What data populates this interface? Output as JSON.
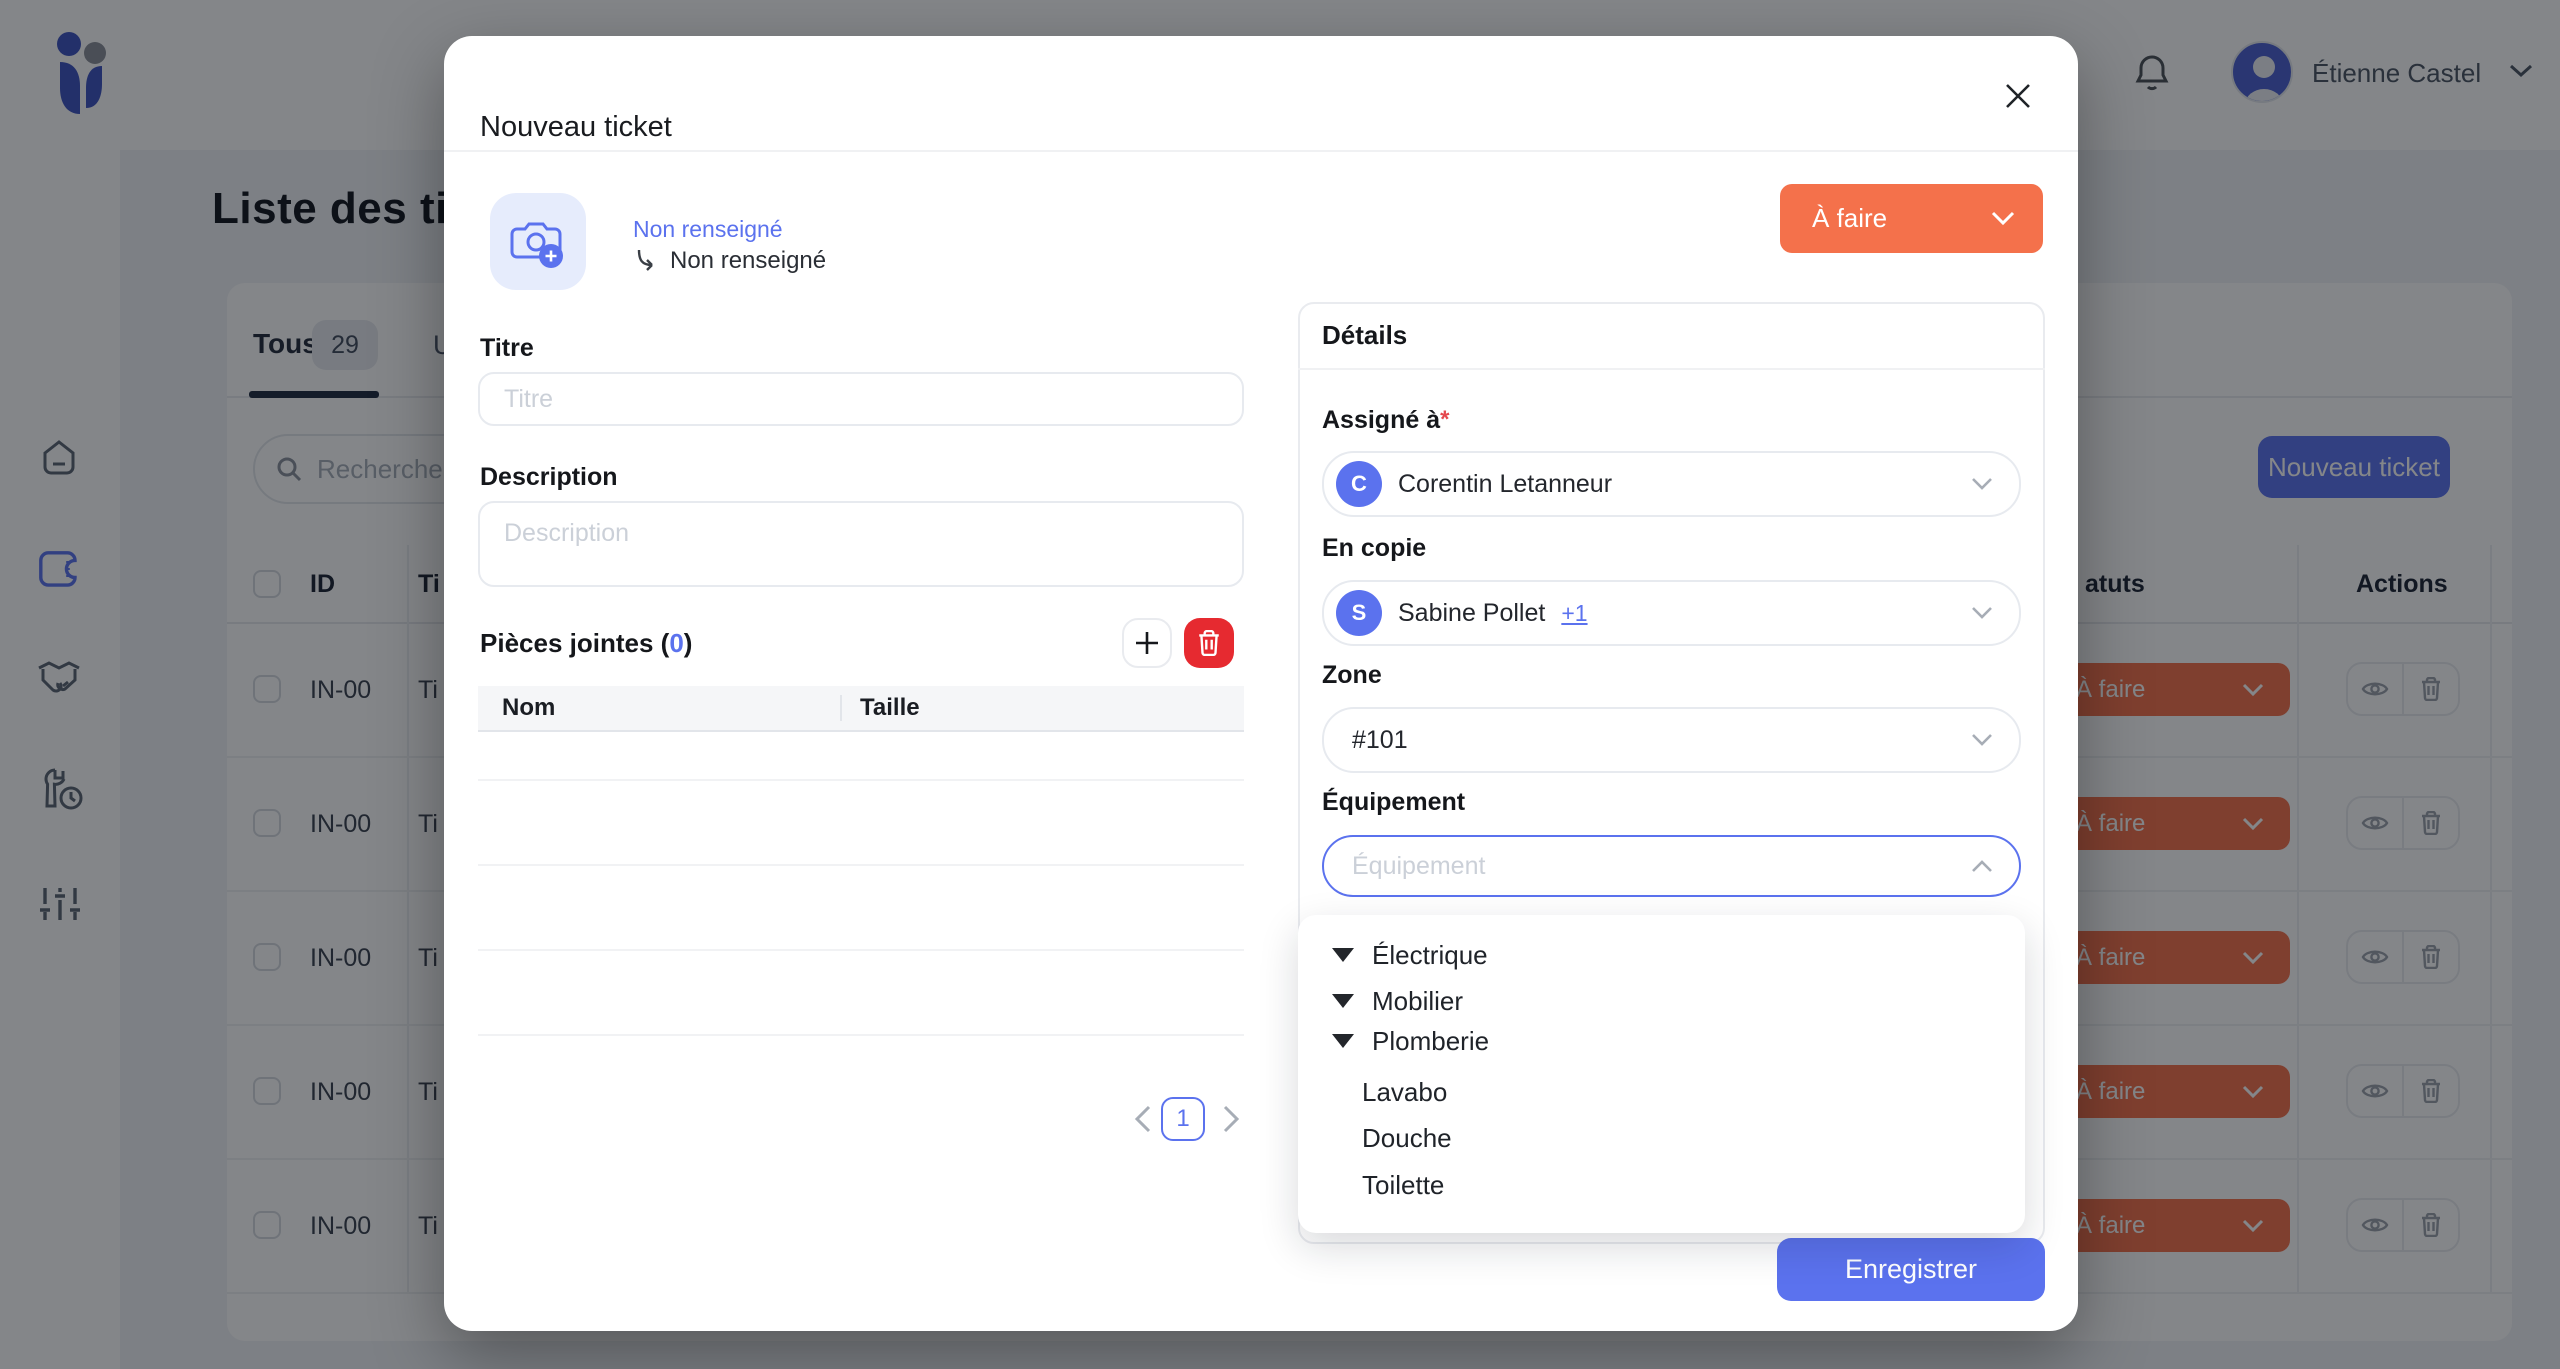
{
  "colors": {
    "accent": "#5B72EE",
    "orange": "#F4714B",
    "red": "#E62A30",
    "navy": "#1E2A40"
  },
  "topbar": {
    "user_name": "Étienne Castel"
  },
  "page": {
    "title": "Liste des ti",
    "tabs": {
      "all_label": "Tous",
      "all_count": "29",
      "second_label": "U"
    },
    "search_placeholder": "Rechercher",
    "new_ticket_label": "Nouveau ticket",
    "table": {
      "col_id": "ID",
      "col_title": "Ti",
      "col_status": "atuts",
      "col_actions": "Actions",
      "rows": [
        {
          "id": "IN-00",
          "title": "Ti",
          "status": "À faire"
        },
        {
          "id": "IN-00",
          "title": "Ti",
          "status": "À faire"
        },
        {
          "id": "IN-00",
          "title": "Ti",
          "status": "À faire"
        },
        {
          "id": "IN-00",
          "title": "Ti",
          "status": "À faire"
        },
        {
          "id": "IN-00",
          "title": "Ti",
          "status": "À faire"
        }
      ]
    }
  },
  "modal": {
    "title": "Nouveau ticket",
    "photo_link": "Non renseigné",
    "photo_secondary": "Non renseigné",
    "status_value": "À faire",
    "title_field": {
      "label": "Titre",
      "placeholder": "Titre"
    },
    "description_field": {
      "label": "Description",
      "placeholder": "Description"
    },
    "attachments": {
      "label_prefix": "Pièces jointes (",
      "count": "0",
      "label_suffix": ")",
      "col_name": "Nom",
      "col_size": "Taille",
      "page_number": "1"
    },
    "details": {
      "heading": "Détails",
      "assigned_label": "Assigné à",
      "required_marker": "*",
      "assigned_value": "Corentin Letanneur",
      "assigned_initial": "C",
      "copy_label": "En copie",
      "copy_value": "Sabine Pollet",
      "copy_extra": "+1",
      "copy_initial": "S",
      "zone_label": "Zone",
      "zone_value": "#101",
      "equipment_label": "Équipement",
      "equipment_placeholder": "Équipement",
      "dropdown_items": [
        {
          "label": "Électrique"
        },
        {
          "label": "Mobilier"
        },
        {
          "label": "Plomberie"
        },
        {
          "label": "Lavabo"
        },
        {
          "label": "Douche"
        },
        {
          "label": "Toilette"
        }
      ]
    },
    "save_label": "Enregistrer"
  }
}
